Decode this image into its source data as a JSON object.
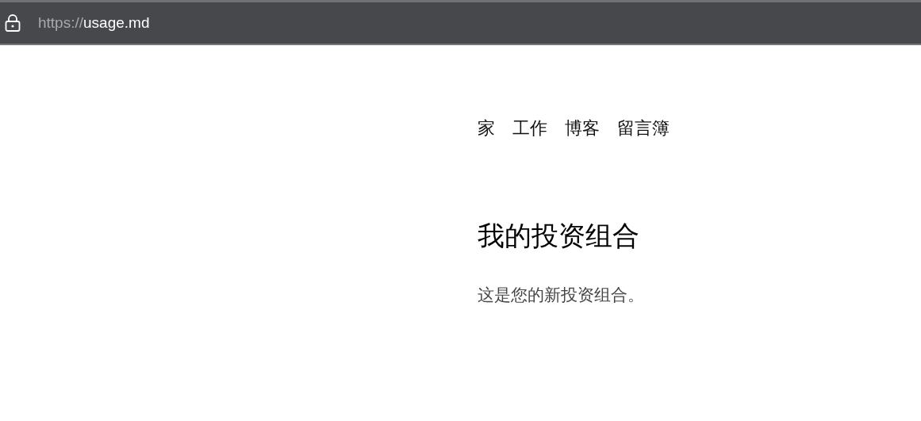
{
  "address_bar": {
    "scheme": "https://",
    "host": "usage.md"
  },
  "nav": [
    {
      "label": "家"
    },
    {
      "label": "工作"
    },
    {
      "label": "博客"
    },
    {
      "label": "留言簿"
    }
  ],
  "heading": "我的投资组合",
  "intro": "这是您的新投资组合。"
}
